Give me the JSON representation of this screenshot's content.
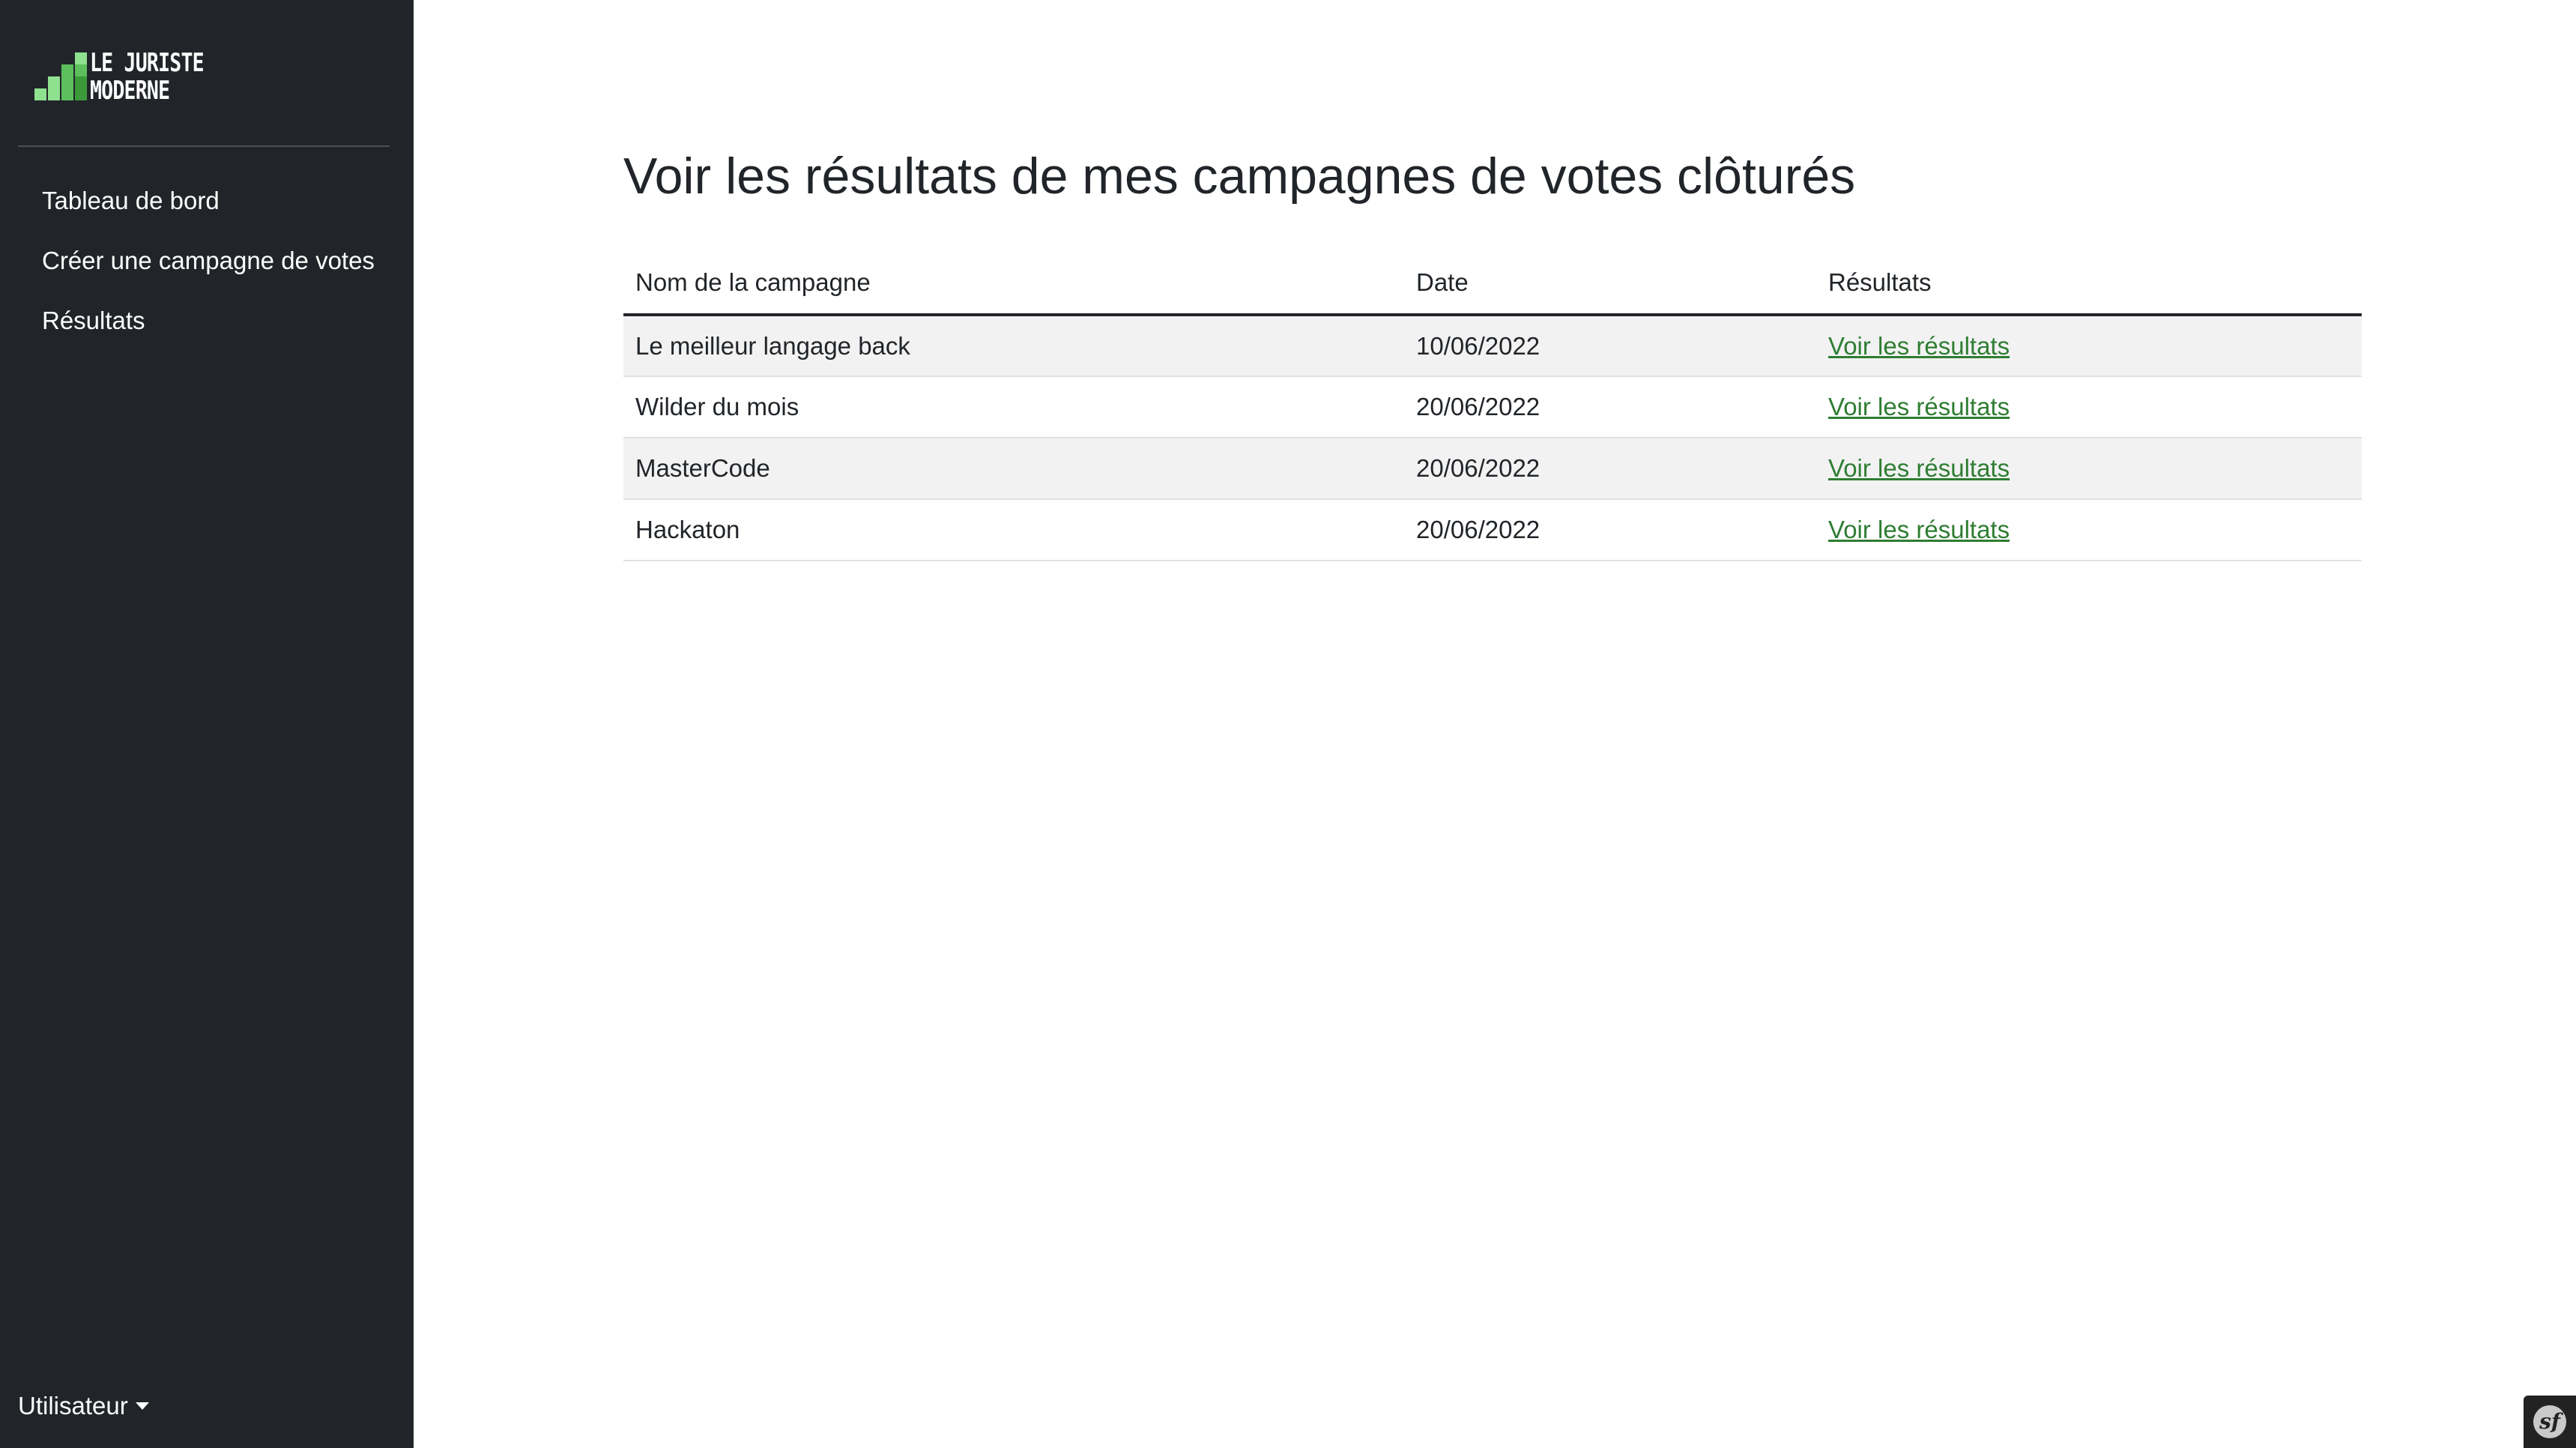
{
  "brand": {
    "line1": "LE JURISTE",
    "line2": "MODERNE",
    "accent_light": "#8fe08f",
    "accent_mid": "#5cbf5c",
    "accent_dark": "#3a9a3a"
  },
  "sidebar": {
    "items": [
      {
        "label": "Tableau de bord"
      },
      {
        "label": "Créer une campagne de votes"
      },
      {
        "label": "Résultats"
      }
    ],
    "user_menu": "Utilisateur"
  },
  "main": {
    "title": "Voir les résultats de mes campagnes de votes clôturés",
    "table": {
      "headers": [
        "Nom de la campagne",
        "Date",
        "Résultats"
      ],
      "rows": [
        {
          "name": "Le meilleur langage back",
          "date": "10/06/2022",
          "link": "Voir les résultats"
        },
        {
          "name": "Wilder du mois",
          "date": "20/06/2022",
          "link": "Voir les résultats"
        },
        {
          "name": "MasterCode",
          "date": "20/06/2022",
          "link": "Voir les résultats"
        },
        {
          "name": "Hackaton",
          "date": "20/06/2022",
          "link": "Voir les résultats"
        }
      ]
    }
  },
  "colors": {
    "sidebar_bg": "#212529",
    "link": "#2e7d32",
    "row_stripe": "#f2f2f2"
  },
  "debug_toolbar": {
    "icon": "symfony-icon",
    "glyph": "sf"
  }
}
